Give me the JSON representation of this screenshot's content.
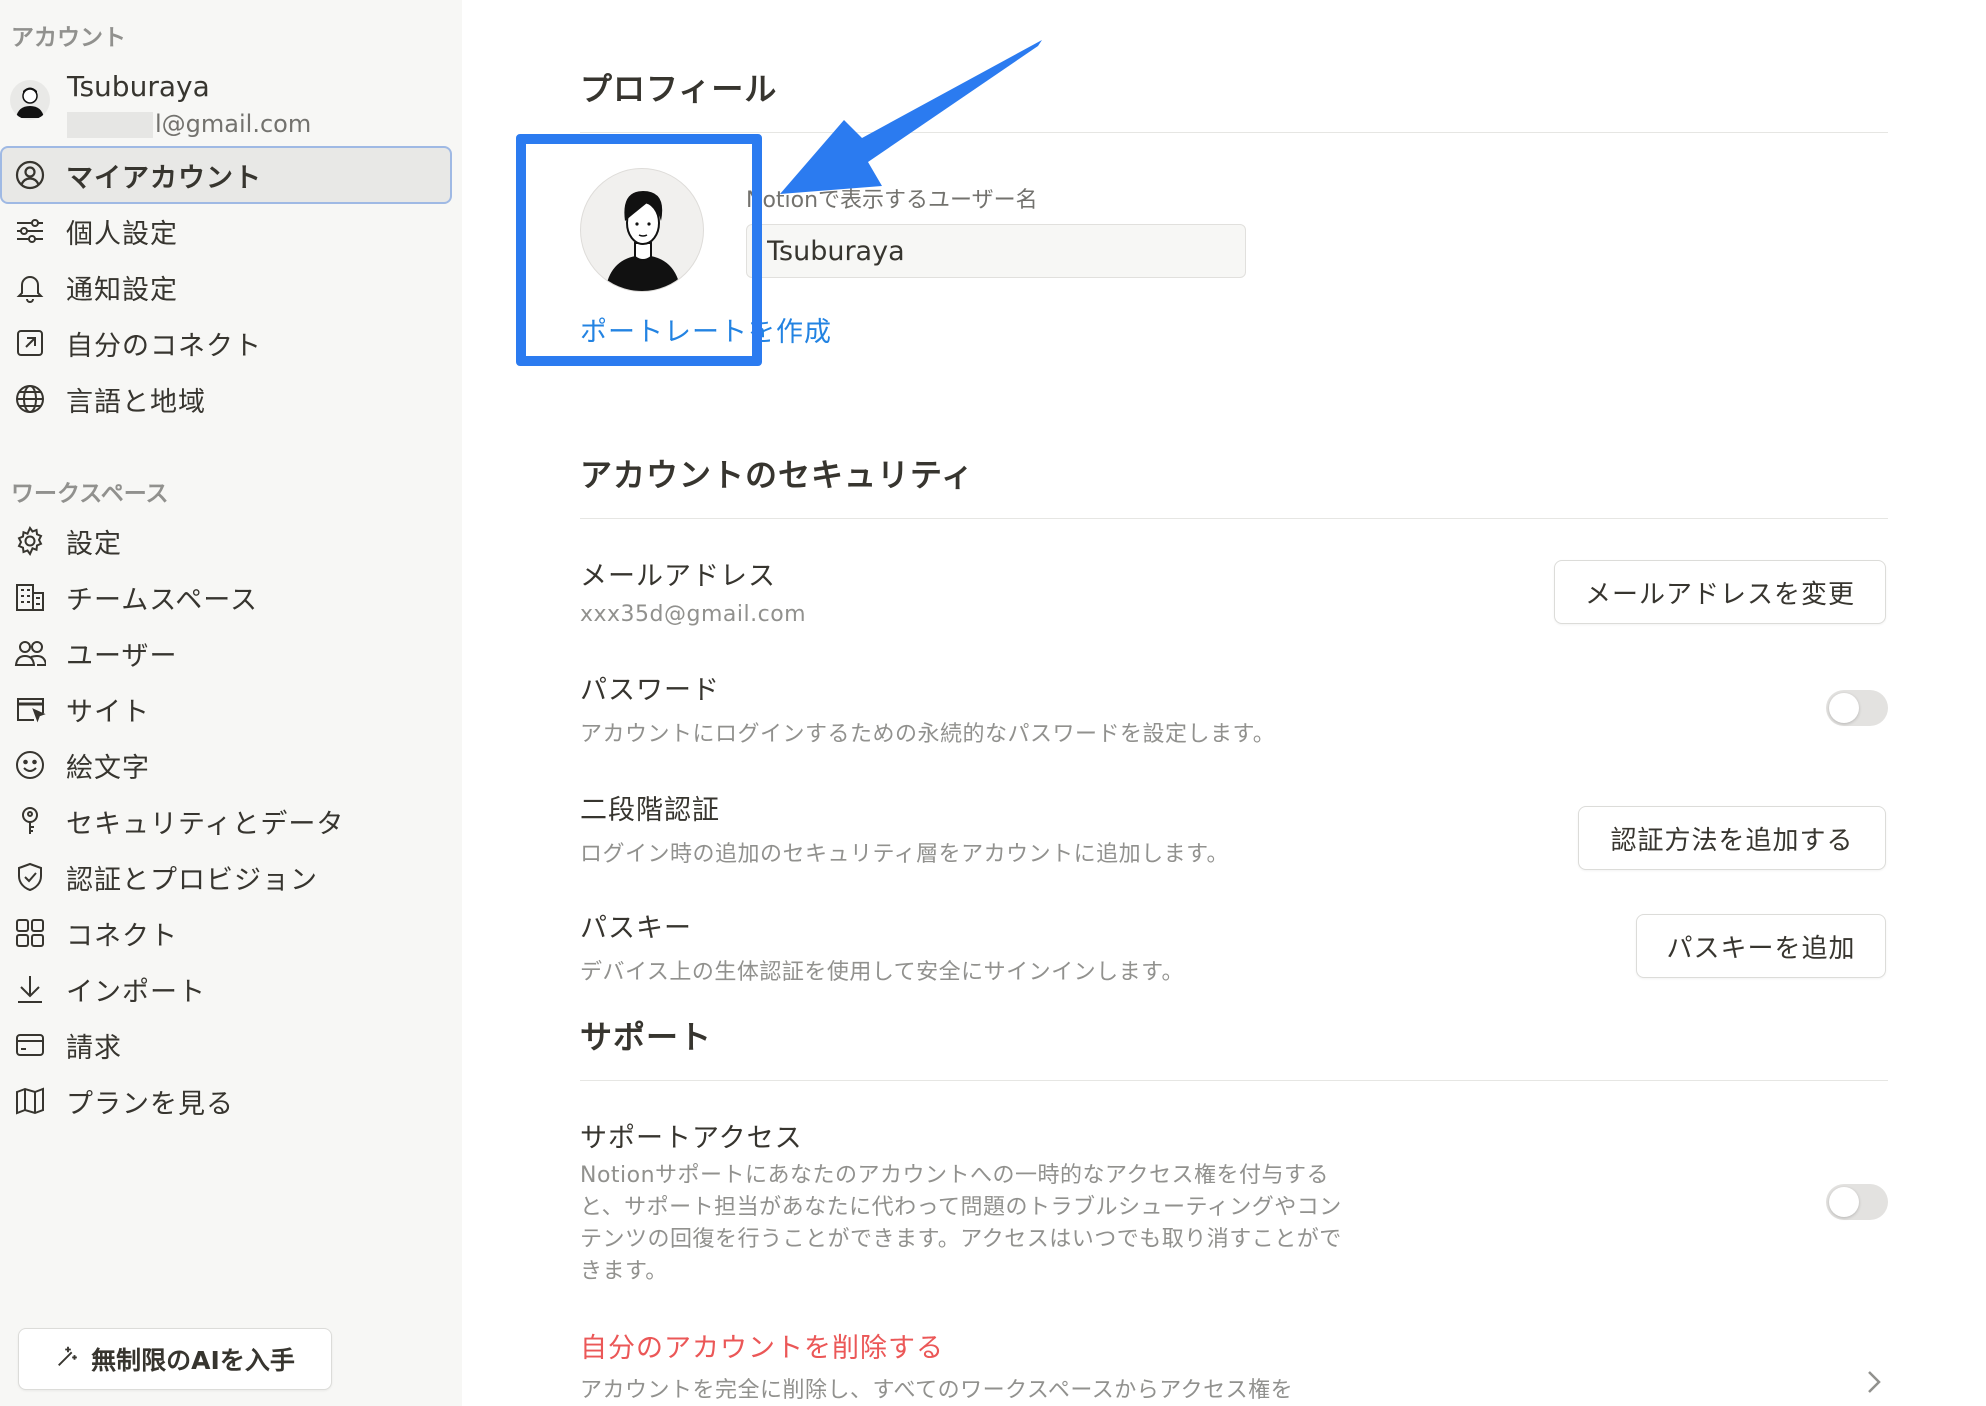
{
  "sidebar": {
    "account_section": "アカウント",
    "user": {
      "name": "Tsuburaya",
      "email_suffix": "l@gmail.com"
    },
    "account_items": [
      {
        "label": "マイアカウント",
        "icon": "user-circle-icon",
        "active": true
      },
      {
        "label": "個人設定",
        "icon": "sliders-icon"
      },
      {
        "label": "通知設定",
        "icon": "bell-icon"
      },
      {
        "label": "自分のコネクト",
        "icon": "external-link-icon"
      },
      {
        "label": "言語と地域",
        "icon": "globe-icon"
      }
    ],
    "workspace_section": "ワークスペース",
    "workspace_items": [
      {
        "label": "設定",
        "icon": "gear-icon"
      },
      {
        "label": "チームスペース",
        "icon": "building-icon"
      },
      {
        "label": "ユーザー",
        "icon": "users-icon"
      },
      {
        "label": "サイト",
        "icon": "browser-cursor-icon"
      },
      {
        "label": "絵文字",
        "icon": "smiley-icon"
      },
      {
        "label": "セキュリティとデータ",
        "icon": "key-icon"
      },
      {
        "label": "認証とプロビジョン",
        "icon": "shield-check-icon"
      },
      {
        "label": "コネクト",
        "icon": "grid-icon"
      },
      {
        "label": "インポート",
        "icon": "download-icon"
      },
      {
        "label": "請求",
        "icon": "credit-card-icon"
      },
      {
        "label": "プランを見る",
        "icon": "map-icon"
      }
    ],
    "ai_button": "無制限のAIを入手"
  },
  "profile": {
    "title": "プロフィール",
    "portrait_link": "ポートレートを作成",
    "name_label": "Notionで表示するユーザー名",
    "name_value": "Tsuburaya"
  },
  "security": {
    "title": "アカウントのセキュリティ",
    "email": {
      "title": "メールアドレス",
      "value": "xxx35d@gmail.com",
      "button": "メールアドレスを変更"
    },
    "password": {
      "title": "パスワード",
      "desc": "アカウントにログインするための永続的なパスワードを設定します。",
      "enabled": false
    },
    "two_factor": {
      "title": "二段階認証",
      "desc": "ログイン時の追加のセキュリティ層をアカウントに追加します。",
      "button": "認証方法を追加する"
    },
    "passkey": {
      "title": "パスキー",
      "desc": "デバイス上の生体認証を使用して安全にサインインします。",
      "button": "パスキーを追加"
    }
  },
  "support": {
    "title": "サポート",
    "access": {
      "title": "サポートアクセス",
      "desc": "Notionサポートにあなたのアカウントへの一時的なアクセス権を付与すると、サポート担当があなたに代わって問題のトラブルシューティングやコンテンツの回復を行うことができます。アクセスはいつでも取り消すことができます。",
      "enabled": false
    },
    "delete": {
      "title": "自分のアカウントを削除する",
      "desc": "アカウントを完全に削除し、すべてのワークスペースからアクセス権を"
    }
  },
  "colors": {
    "highlight": "#2b7bf0",
    "link": "#2383e2",
    "danger": "#eb5757"
  }
}
